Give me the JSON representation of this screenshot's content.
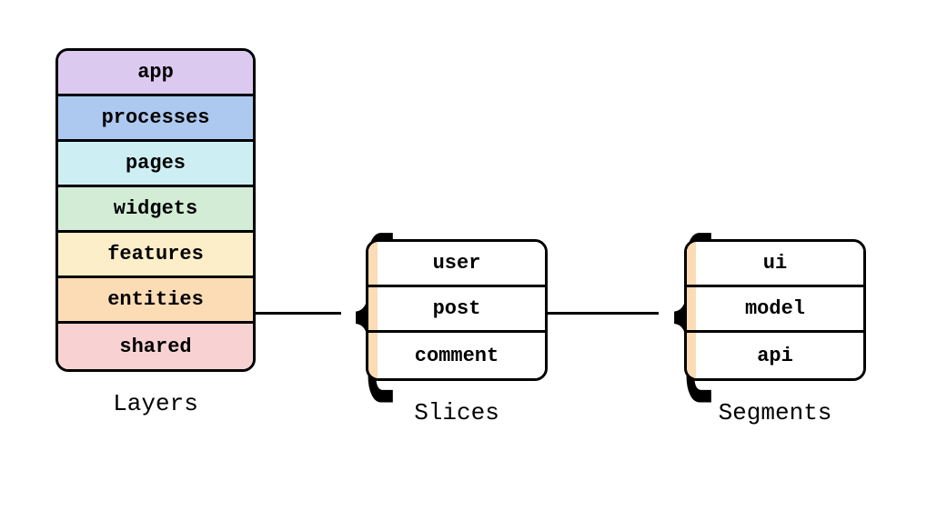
{
  "layers": {
    "label": "Layers",
    "items": [
      {
        "label": "app"
      },
      {
        "label": "processes"
      },
      {
        "label": "pages"
      },
      {
        "label": "widgets"
      },
      {
        "label": "features"
      },
      {
        "label": "entities"
      },
      {
        "label": "shared"
      }
    ]
  },
  "slices": {
    "label": "Slices",
    "items": [
      {
        "label": "user"
      },
      {
        "label": "post"
      },
      {
        "label": "comment"
      }
    ]
  },
  "segments": {
    "label": "Segments",
    "items": [
      {
        "label": "ui"
      },
      {
        "label": "model"
      },
      {
        "label": "api"
      }
    ]
  }
}
